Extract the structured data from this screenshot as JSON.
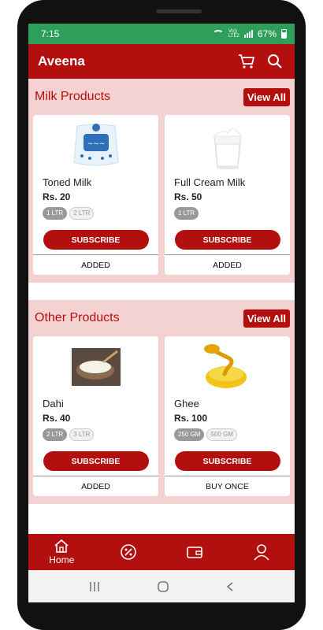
{
  "status_bar": {
    "time": "7:15",
    "network": "Vo)) LTE2",
    "battery": "67%"
  },
  "app_bar": {
    "title": "Aveena",
    "icons": [
      "cart-icon",
      "search-icon"
    ]
  },
  "colors": {
    "primary": "#b30f0f",
    "section_bg": "#f5d2d2",
    "status_bar": "#2e9e5b"
  },
  "sections": [
    {
      "title": "Milk Products",
      "view_all": "View All",
      "products": [
        {
          "name": "Toned Milk",
          "price": "Rs. 20",
          "sizes": [
            "1 LTR",
            "2 LTR"
          ],
          "selected": 0,
          "button": "SUBSCRIBE",
          "status": "ADDED"
        },
        {
          "name": "Full Cream Milk",
          "price": "Rs. 50",
          "sizes": [
            "1 LTR"
          ],
          "selected": 0,
          "button": "SUBSCRIBE",
          "status": "ADDED"
        }
      ]
    },
    {
      "title": "Other Products",
      "view_all": "View All",
      "products": [
        {
          "name": "Dahi",
          "price": "Rs. 40",
          "sizes": [
            "2 LTR",
            "3 LTR"
          ],
          "selected": 0,
          "button": "SUBSCRIBE",
          "status": "ADDED"
        },
        {
          "name": "Ghee",
          "price": "Rs. 100",
          "sizes": [
            "250 GM",
            "500 GM"
          ],
          "selected": 0,
          "button": "SUBSCRIBE",
          "status": "BUY ONCE"
        }
      ]
    }
  ],
  "bottom_nav": {
    "home_label": "Home",
    "icons": [
      "home-icon",
      "discount-icon",
      "wallet-icon",
      "profile-icon"
    ]
  },
  "system_nav": [
    "recent-apps-icon",
    "home-circle-icon",
    "back-icon"
  ]
}
